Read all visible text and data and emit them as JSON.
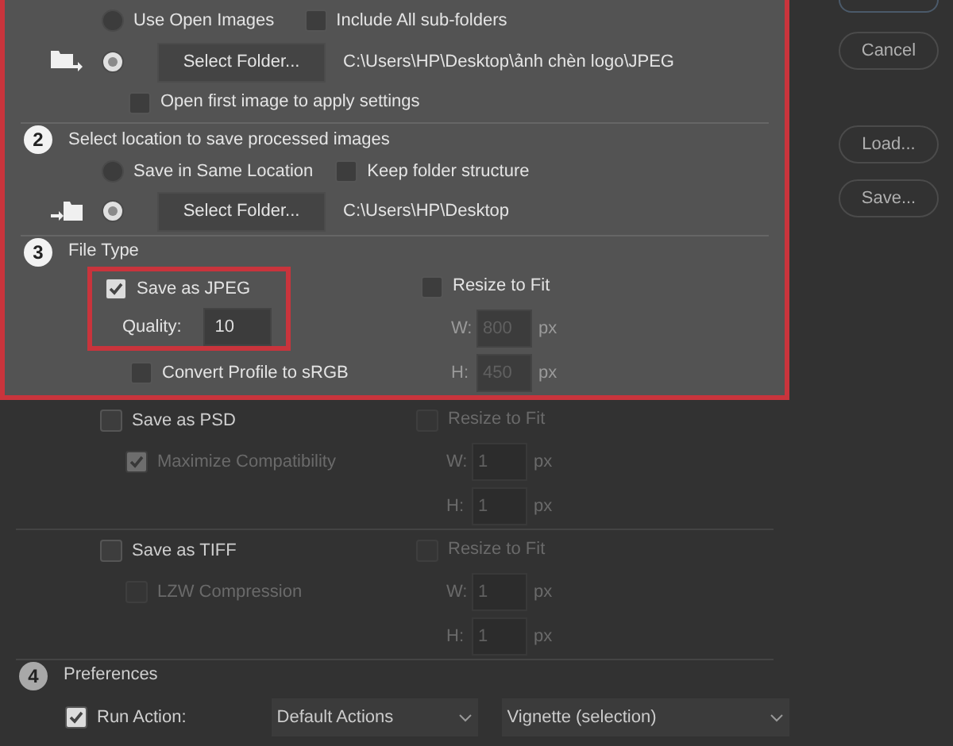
{
  "source": {
    "use_open_images": {
      "label": "Use Open Images",
      "selected": false
    },
    "include_subfolders": {
      "label": "Include All sub-folders",
      "checked": false
    },
    "folder_option": {
      "selected": true,
      "button": "Select Folder...",
      "path": "C:\\Users\\HP\\Desktop\\ảnh chèn logo\\JPEG"
    },
    "open_first_image": {
      "label": "Open first image to apply settings",
      "checked": false
    }
  },
  "destination": {
    "number": "2",
    "title": "Select location to save processed images",
    "same_location": {
      "label": "Save in Same Location",
      "selected": false
    },
    "keep_structure": {
      "label": "Keep folder structure",
      "checked": false
    },
    "folder_option": {
      "selected": true,
      "button": "Select Folder...",
      "path": "C:\\Users\\HP\\Desktop"
    }
  },
  "file_type": {
    "number": "3",
    "title": "File Type",
    "formats": [
      {
        "label": "Save as JPEG",
        "checked": true,
        "highlighted": true,
        "options": [
          {
            "kind": "quality",
            "label": "Quality:",
            "value": "10"
          },
          {
            "kind": "checkbox",
            "label": "Convert Profile to sRGB",
            "checked": false,
            "disabled": false
          }
        ],
        "resize": {
          "label": "Resize to Fit",
          "checked": false,
          "disabled": false,
          "w_label": "W:",
          "w_value": "800",
          "w_unit": "px",
          "h_label": "H:",
          "h_value": "450",
          "h_unit": "px"
        }
      },
      {
        "label": "Save as PSD",
        "checked": false,
        "highlighted": false,
        "options": [
          {
            "kind": "checkbox",
            "label": "Maximize Compatibility",
            "checked": true,
            "disabled": true
          }
        ],
        "resize": {
          "label": "Resize to Fit",
          "checked": false,
          "disabled": true,
          "w_label": "W:",
          "w_value": "1",
          "w_unit": "px",
          "h_label": "H:",
          "h_value": "1",
          "h_unit": "px"
        }
      },
      {
        "label": "Save as TIFF",
        "checked": false,
        "highlighted": false,
        "options": [
          {
            "kind": "checkbox",
            "label": "LZW Compression",
            "checked": false,
            "disabled": true
          }
        ],
        "resize": {
          "label": "Resize to Fit",
          "checked": false,
          "disabled": true,
          "w_label": "W:",
          "w_value": "1",
          "w_unit": "px",
          "h_label": "H:",
          "h_value": "1",
          "h_unit": "px"
        }
      }
    ]
  },
  "preferences": {
    "number": "4",
    "title": "Preferences",
    "run_action": {
      "label": "Run Action:",
      "checked": true
    },
    "action_set": "Default Actions",
    "action": "Vignette (selection)"
  },
  "buttons": [
    {
      "kind": "cut"
    },
    {
      "kind": "button",
      "label": "Cancel"
    },
    {
      "kind": "button",
      "label": "Load..."
    },
    {
      "kind": "button",
      "label": "Save..."
    }
  ]
}
